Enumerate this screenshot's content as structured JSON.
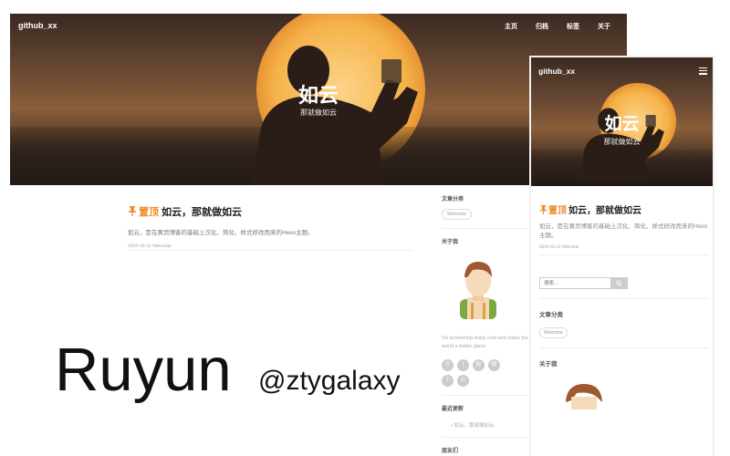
{
  "desktop": {
    "brand": "github_xx",
    "nav": [
      "主页",
      "归档",
      "标签",
      "关于"
    ],
    "hero": {
      "title": "如云",
      "subtitle": "那就做如云"
    },
    "post": {
      "top_tag": "置顶",
      "title": "如云，那就做如云",
      "excerpt": "如云，是在黄页博客的基础上汉化、简化、样式修改而来的Hexo主题。",
      "meta": "2019-10-31 Welcome"
    },
    "sidebar": {
      "categories_title": "文章分类",
      "category_tag": "Welcome",
      "about_title": "关于我",
      "motto": "Do something really cool and make the world a better place.",
      "social_icons": [
        "rss-icon",
        "twitter-icon",
        "zhihu-icon",
        "weibo-icon",
        "facebook-icon",
        "github-icon"
      ],
      "social_glyphs": [
        "R",
        "t",
        "知",
        "微",
        "f",
        "G"
      ],
      "recent_title": "最近更新",
      "recent_item": "如云，那就做如云",
      "links_title": "朋友们"
    }
  },
  "mobile": {
    "brand": "github_xx",
    "hero": {
      "title": "如云",
      "subtitle": "那就做如云"
    },
    "post": {
      "top_tag": "置顶",
      "title": "如云，那就做如云",
      "excerpt": "如云，是在黄页博客的基础上汉化、简化、样式修改而来的Hexo主题。",
      "meta": "2019-10-31 Welcome"
    },
    "search_placeholder": "搜索...",
    "categories_title": "文章分类",
    "category_tag": "Welcome",
    "about_title": "关于我"
  },
  "watermark": {
    "name": "Ruyun",
    "handle": "@ztygalaxy"
  },
  "colors": {
    "accent": "#f08a24",
    "text": "#222222",
    "muted": "#999999"
  }
}
